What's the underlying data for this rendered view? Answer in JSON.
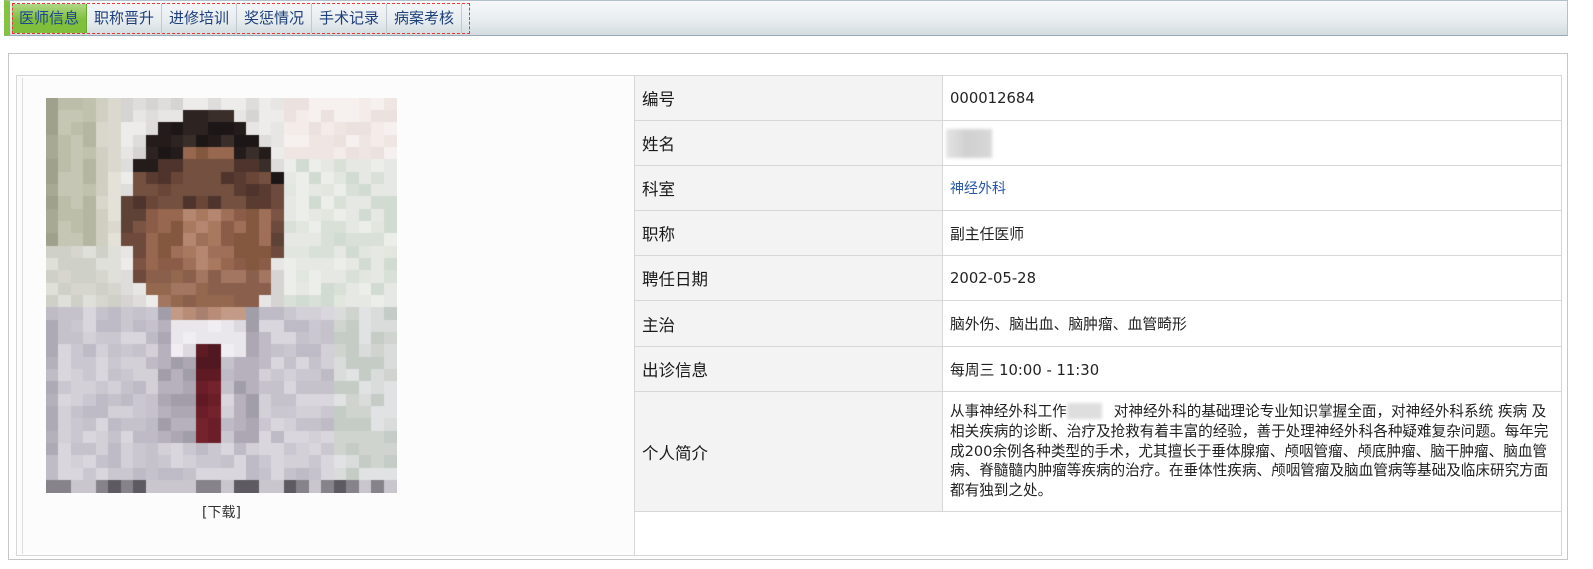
{
  "tabs": [
    {
      "label": "医师信息",
      "active": true
    },
    {
      "label": "职称晋升",
      "active": false
    },
    {
      "label": "进修培训",
      "active": false
    },
    {
      "label": "奖惩情况",
      "active": false
    },
    {
      "label": "手术记录",
      "active": false
    },
    {
      "label": "病案考核",
      "active": false
    }
  ],
  "photo": {
    "download_label": "[下载]"
  },
  "profile": {
    "rows": [
      {
        "label": "编号",
        "value": "000012684"
      },
      {
        "label": "姓名"
      },
      {
        "label": "科室",
        "value": "神经外科"
      },
      {
        "label": "职称",
        "value": "副主任医师"
      },
      {
        "label": "聘任日期",
        "value": "2002-05-28"
      },
      {
        "label": "主治",
        "value": "脑外伤、脑出血、脑肿瘤、血管畸形"
      },
      {
        "label": "出诊信息",
        "value": "每周三 10:00 - 11:30"
      },
      {
        "label": "个人简介"
      }
    ],
    "bio": {
      "first_line_start": "从事神经外科工作",
      "first_line_end": "对神经外科的基础理论专业知识掌握全面，对神经外科系统 疾病 及",
      "lines": [
        "相关疾病的诊断、治疗及抢救有着丰富的经验，善于处理神经外科各种疑难复杂问题。每年完",
        "成200余例各种类型的手术，尤其擅长于垂体腺瘤、颅咽管瘤、颅底肿瘤、脑干肿瘤、脑血管",
        "病、脊髓髓内肿瘤等疾病的治疗。在垂体性疾病、颅咽管瘤及脑血管病等基础及临床研究方面",
        "都有独到之处。"
      ]
    }
  },
  "colors": {
    "active_tab": "#7fbf3c",
    "tab_text": "#1e3f7a",
    "link": "#2a58a8",
    "focus_outline": "#e23b3b",
    "label_cell_bg": "#f3f3f3"
  }
}
